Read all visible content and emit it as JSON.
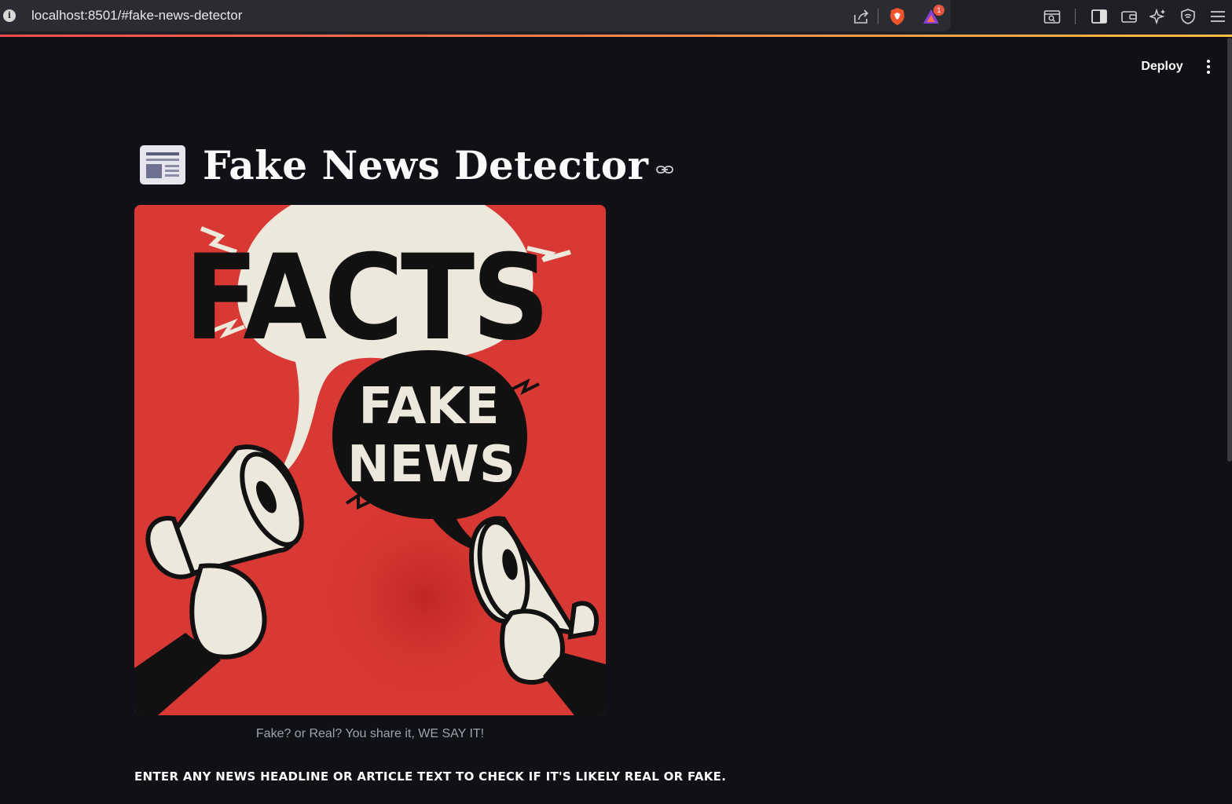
{
  "browser": {
    "url": "localhost:8501/#fake-news-detector",
    "notification_count": "1"
  },
  "header": {
    "deploy_label": "Deploy"
  },
  "main": {
    "title": "Fake News Detector",
    "hero_image": {
      "big_word": "FACTS",
      "small_word_1": "FAKE",
      "small_word_2": "NEWS"
    },
    "caption": "Fake? or Real? You share it, WE SAY IT!",
    "instruction": "ENTER ANY NEWS HEADLINE OR ARTICLE TEXT TO CHECK IF IT'S LIKELY REAL OR FAKE."
  },
  "colors": {
    "background": "#0f1117",
    "hero_red": "#d93934",
    "bubble_cream": "#ece9dc",
    "accent": "#ff4b4b"
  }
}
